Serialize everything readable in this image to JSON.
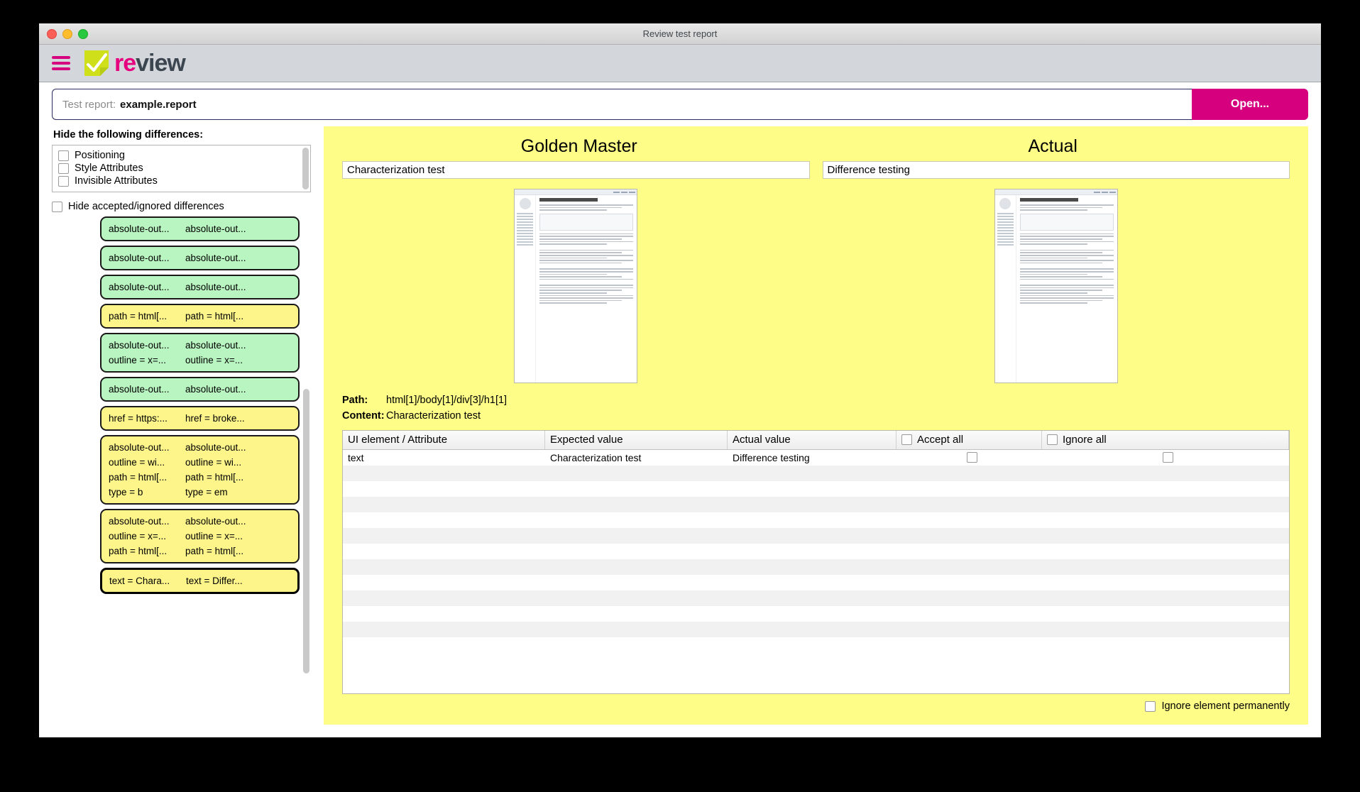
{
  "window": {
    "title": "Review test report",
    "brand_pink": "#e6007e",
    "brand_dark": "#3c4650",
    "accent_magenta": "#d6007f",
    "panel_yellow": "#fdfd87",
    "card_green": "#b9f5c0",
    "card_yellow": "#fdf58a",
    "logo_name_1": "re",
    "logo_name_2": "view"
  },
  "report": {
    "label": "Test report:",
    "value": "example.report",
    "open_button": "Open..."
  },
  "sidebar": {
    "hide_title": "Hide the following differences:",
    "filters": [
      {
        "label": "Positioning",
        "checked": false
      },
      {
        "label": "Style Attributes",
        "checked": false
      },
      {
        "label": "Invisible Attributes",
        "checked": false
      }
    ],
    "hide_accepted": {
      "label": "Hide accepted/ignored differences",
      "checked": false
    },
    "diff_cards": [
      {
        "color": "green",
        "selected": false,
        "lines": [
          [
            "absolute-out...",
            "absolute-out..."
          ]
        ]
      },
      {
        "color": "green",
        "selected": false,
        "lines": [
          [
            "absolute-out...",
            "absolute-out..."
          ]
        ]
      },
      {
        "color": "green",
        "selected": false,
        "lines": [
          [
            "absolute-out...",
            "absolute-out..."
          ]
        ]
      },
      {
        "color": "yellow",
        "selected": false,
        "lines": [
          [
            "path = html[...",
            "path = html[..."
          ]
        ]
      },
      {
        "color": "green",
        "selected": false,
        "lines": [
          [
            "absolute-out...",
            "absolute-out..."
          ],
          [
            "outline = x=...",
            "outline = x=..."
          ]
        ]
      },
      {
        "color": "green",
        "selected": false,
        "lines": [
          [
            "absolute-out...",
            "absolute-out..."
          ]
        ]
      },
      {
        "color": "yellow",
        "selected": false,
        "lines": [
          [
            "href = https:...",
            "href = broke..."
          ]
        ]
      },
      {
        "color": "yellow",
        "selected": false,
        "lines": [
          [
            "absolute-out...",
            "absolute-out..."
          ],
          [
            "outline = wi...",
            "outline = wi..."
          ],
          [
            "path = html[...",
            "path = html[..."
          ],
          [
            "type = b",
            "type = em"
          ]
        ]
      },
      {
        "color": "yellow",
        "selected": false,
        "lines": [
          [
            "absolute-out...",
            "absolute-out..."
          ],
          [
            "outline = x=...",
            "outline = x=..."
          ],
          [
            "path = html[...",
            "path = html[..."
          ]
        ]
      },
      {
        "color": "yellow",
        "selected": true,
        "lines": [
          [
            "text = Chara...",
            "text = Differ..."
          ]
        ]
      }
    ]
  },
  "main": {
    "golden_master_title": "Golden Master",
    "actual_title": "Actual",
    "golden_master_value": "Characterization test",
    "actual_value": "Difference testing",
    "path_label": "Path:",
    "path_value": "html[1]/body[1]/div[3]/h1[1]",
    "content_label": "Content:",
    "content_value": "Characterization test",
    "table": {
      "headers": {
        "element": "UI element / Attribute",
        "expected": "Expected value",
        "actual": "Actual value",
        "accept_all": "Accept all",
        "ignore_all": "Ignore all"
      },
      "accept_all_checked": false,
      "ignore_all_checked": false,
      "rows": [
        {
          "element": "text",
          "expected": "Characterization test",
          "actual": "Difference testing",
          "accept": false,
          "ignore": false
        }
      ]
    },
    "ignore_permanently": {
      "label": "Ignore element permanently",
      "checked": false
    }
  }
}
